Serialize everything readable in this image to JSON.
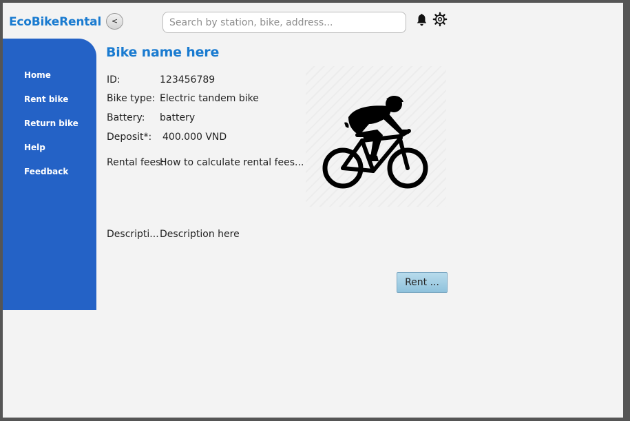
{
  "app": {
    "brand": "EcoBikeRental",
    "back_label": "<"
  },
  "search": {
    "placeholder": "Search by station, bike, address..."
  },
  "sidebar": {
    "items": [
      {
        "label": "Home"
      },
      {
        "label": "Rent bike"
      },
      {
        "label": "Return bike"
      },
      {
        "label": "Help"
      },
      {
        "label": "Feedback"
      }
    ]
  },
  "bike": {
    "name": "Bike name here",
    "id_label": "ID:",
    "id_value": "123456789",
    "type_label": "Bike type:",
    "type_value": "Electric tandem bike",
    "battery_label": "Battery:",
    "battery_value": "battery",
    "deposit_label": "Deposit*:",
    "deposit_value": "400.000 VND",
    "fees_label": "Rental fees:",
    "fees_value": "How to calculate rental fees...",
    "description_label": "Descripti...",
    "description_value": "Description here",
    "image_icon": "cyclist-icon"
  },
  "actions": {
    "rent_label": "Rent ..."
  },
  "colors": {
    "accent": "#1a7bd0",
    "sidebar": "#2462c6",
    "rent_button": "#a6d0e6"
  },
  "icons": {
    "notifications": "bell-icon",
    "settings": "gear-icon"
  }
}
